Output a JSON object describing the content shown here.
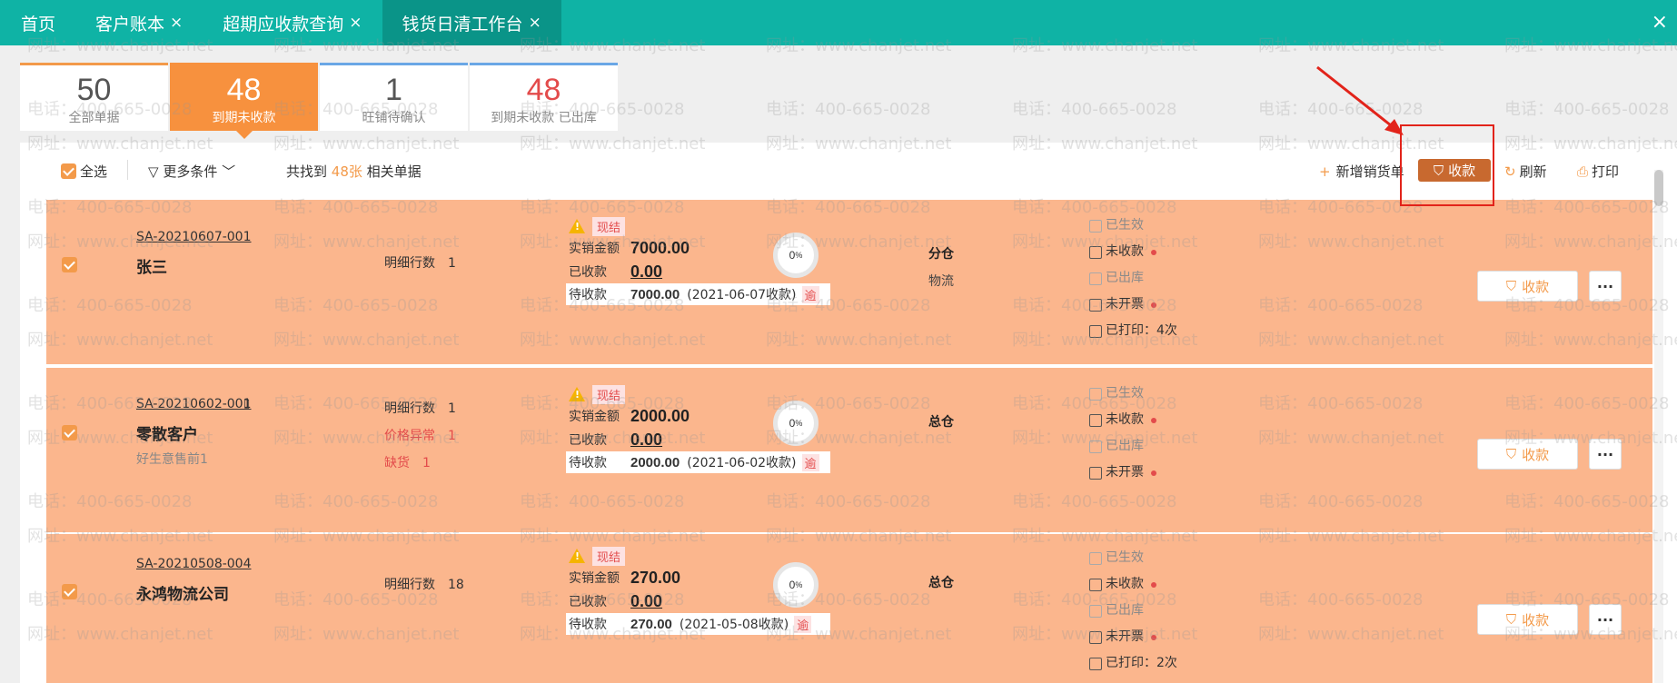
{
  "tabs": [
    {
      "label": "首页",
      "closable": false,
      "active": false
    },
    {
      "label": "客户账本",
      "closable": true,
      "active": false
    },
    {
      "label": "超期应收款查询",
      "closable": true,
      "active": false
    },
    {
      "label": "钱货日清工作台",
      "closable": true,
      "active": true
    }
  ],
  "close_all": "×",
  "cards": [
    {
      "num": "50",
      "label": "全部单据"
    },
    {
      "num": "48",
      "label": "到期未收款"
    },
    {
      "num": "1",
      "label": "旺铺待确认"
    },
    {
      "num": "48",
      "label": "到期未收款 已出库"
    }
  ],
  "toolbar": {
    "select_all": "全选",
    "more_filters": "更多条件",
    "found_prefix": "共找到",
    "found_count": "48张",
    "found_suffix": "相关单据",
    "add_sales": "新增销货单",
    "collect": "收款",
    "refresh": "刷新",
    "print": "打印"
  },
  "rows": [
    {
      "code": "SA-20210607-001",
      "name": "张三",
      "sub": "",
      "detail_lines": [
        {
          "k": "明细行数",
          "v": "1",
          "warn": false
        }
      ],
      "cash_tag": "现结",
      "amount_label": "实销金额",
      "amount": "7000.00",
      "received_label": "已收款",
      "received": "0.00",
      "pending_label": "待收款",
      "pending": "7000.00",
      "pending_date": "(2021-06-07收款)",
      "overdue": "逾",
      "percent": "0",
      "warehouse": "分仓",
      "logistics": "物流",
      "statuses": [
        {
          "t": "已生效",
          "dim": true,
          "dot": false
        },
        {
          "t": "未收款",
          "dim": false,
          "dot": true
        },
        {
          "t": "已出库",
          "dim": true,
          "dot": false
        },
        {
          "t": "未开票",
          "dim": false,
          "dot": true
        },
        {
          "t": "已打印：4次",
          "dim": false,
          "dot": false
        }
      ],
      "collect": "收款",
      "more": "···"
    },
    {
      "code": "SA-20210602-001",
      "name": "零散客户",
      "sub": "好生意售前1",
      "detail_lines": [
        {
          "k": "明细行数",
          "v": "1",
          "warn": false
        },
        {
          "k": "价格异常",
          "v": "1",
          "warn": true
        },
        {
          "k": "缺货",
          "v": "1",
          "warn": true
        }
      ],
      "cash_tag": "现结",
      "amount_label": "实销金额",
      "amount": "2000.00",
      "received_label": "已收款",
      "received": "0.00",
      "pending_label": "待收款",
      "pending": "2000.00",
      "pending_date": "(2021-06-02收款)",
      "overdue": "逾",
      "percent": "0",
      "warehouse": "总仓",
      "logistics": "",
      "statuses": [
        {
          "t": "已生效",
          "dim": true,
          "dot": false
        },
        {
          "t": "未收款",
          "dim": false,
          "dot": true
        },
        {
          "t": "已出库",
          "dim": true,
          "dot": false
        },
        {
          "t": "未开票",
          "dim": false,
          "dot": true
        }
      ],
      "collect": "收款",
      "more": "···"
    },
    {
      "code": "SA-20210508-004",
      "name": "永鸿物流公司",
      "sub": "",
      "detail_lines": [
        {
          "k": "明细行数",
          "v": "18",
          "warn": false
        }
      ],
      "cash_tag": "现结",
      "amount_label": "实销金额",
      "amount": "270.00",
      "received_label": "已收款",
      "received": "0.00",
      "pending_label": "待收款",
      "pending": "270.00",
      "pending_date": "(2021-05-08收款)",
      "overdue": "逾",
      "percent": "0",
      "warehouse": "总仓",
      "logistics": "",
      "statuses": [
        {
          "t": "已生效",
          "dim": true,
          "dot": false
        },
        {
          "t": "未收款",
          "dim": false,
          "dot": true
        },
        {
          "t": "已出库",
          "dim": true,
          "dot": false
        },
        {
          "t": "未开票",
          "dim": false,
          "dot": true
        },
        {
          "t": "已打印：2次",
          "dim": false,
          "dot": false
        }
      ],
      "collect": "收款",
      "more": "···"
    }
  ],
  "watermark": {
    "phone": "电话：400-665-0028",
    "site": "网址：www.chanjet.net"
  },
  "colors": {
    "teal": "#0fb3a5",
    "orange": "#f7913e",
    "row_bg": "#fbb68d",
    "highlight": "#e2231a"
  }
}
